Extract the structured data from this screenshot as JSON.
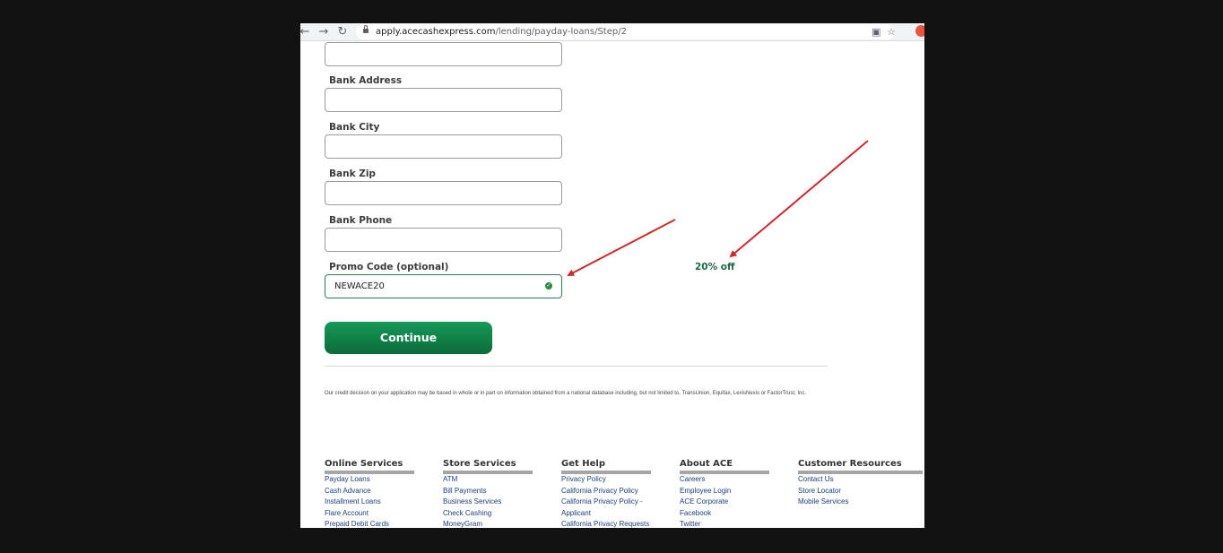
{
  "browser": {
    "url_domain": "apply.acecashexpress.com",
    "url_path": "/lending/payday-loans/Step/2",
    "back_icon": "arrow-left-icon",
    "forward_icon": "arrow-right-icon",
    "reload_icon": "reload-icon"
  },
  "form": {
    "bank_address_label": "Bank Address",
    "bank_city_label": "Bank City",
    "bank_zip_label": "Bank Zip",
    "bank_phone_label": "Bank Phone",
    "promo_label": "Promo Code (optional)",
    "promo_value": "NEWACE20",
    "continue_label": "Continue"
  },
  "annotation": {
    "promo_note": "20% off",
    "arrow_color": "#cc2a2a"
  },
  "disclaimer": "Our credit decision on your application may be based in whole or in part on information obtained from a national database including, but not limited to, TransUnion, Equifax, LexisNexis or FactorTrust, Inc.",
  "footer": {
    "columns": [
      {
        "heading": "Online Services",
        "items": [
          "Payday Loans",
          "Cash Advance",
          "Installment Loans",
          "Flare Account",
          "Prepaid Debit Cards"
        ]
      },
      {
        "heading": "Store Services",
        "items": [
          "ATM",
          "Bill Payments",
          "Business Services",
          "Check Cashing",
          "MoneyGram"
        ]
      },
      {
        "heading": "Get Help",
        "items": [
          "Privacy Policy",
          "California Privacy Policy",
          "California Privacy Policy -",
          "Applicant",
          "California Privacy Requests"
        ]
      },
      {
        "heading": "About ACE",
        "items": [
          "Careers",
          "Employee Login",
          "ACE Corporate",
          "Facebook",
          "Twitter"
        ]
      },
      {
        "heading": "Customer Resources",
        "items": [
          "Contact Us",
          "Store Locator",
          "Mobile Services"
        ]
      }
    ]
  },
  "colors": {
    "brand_green": "#0f7f48",
    "link_blue": "#1f3f78"
  }
}
